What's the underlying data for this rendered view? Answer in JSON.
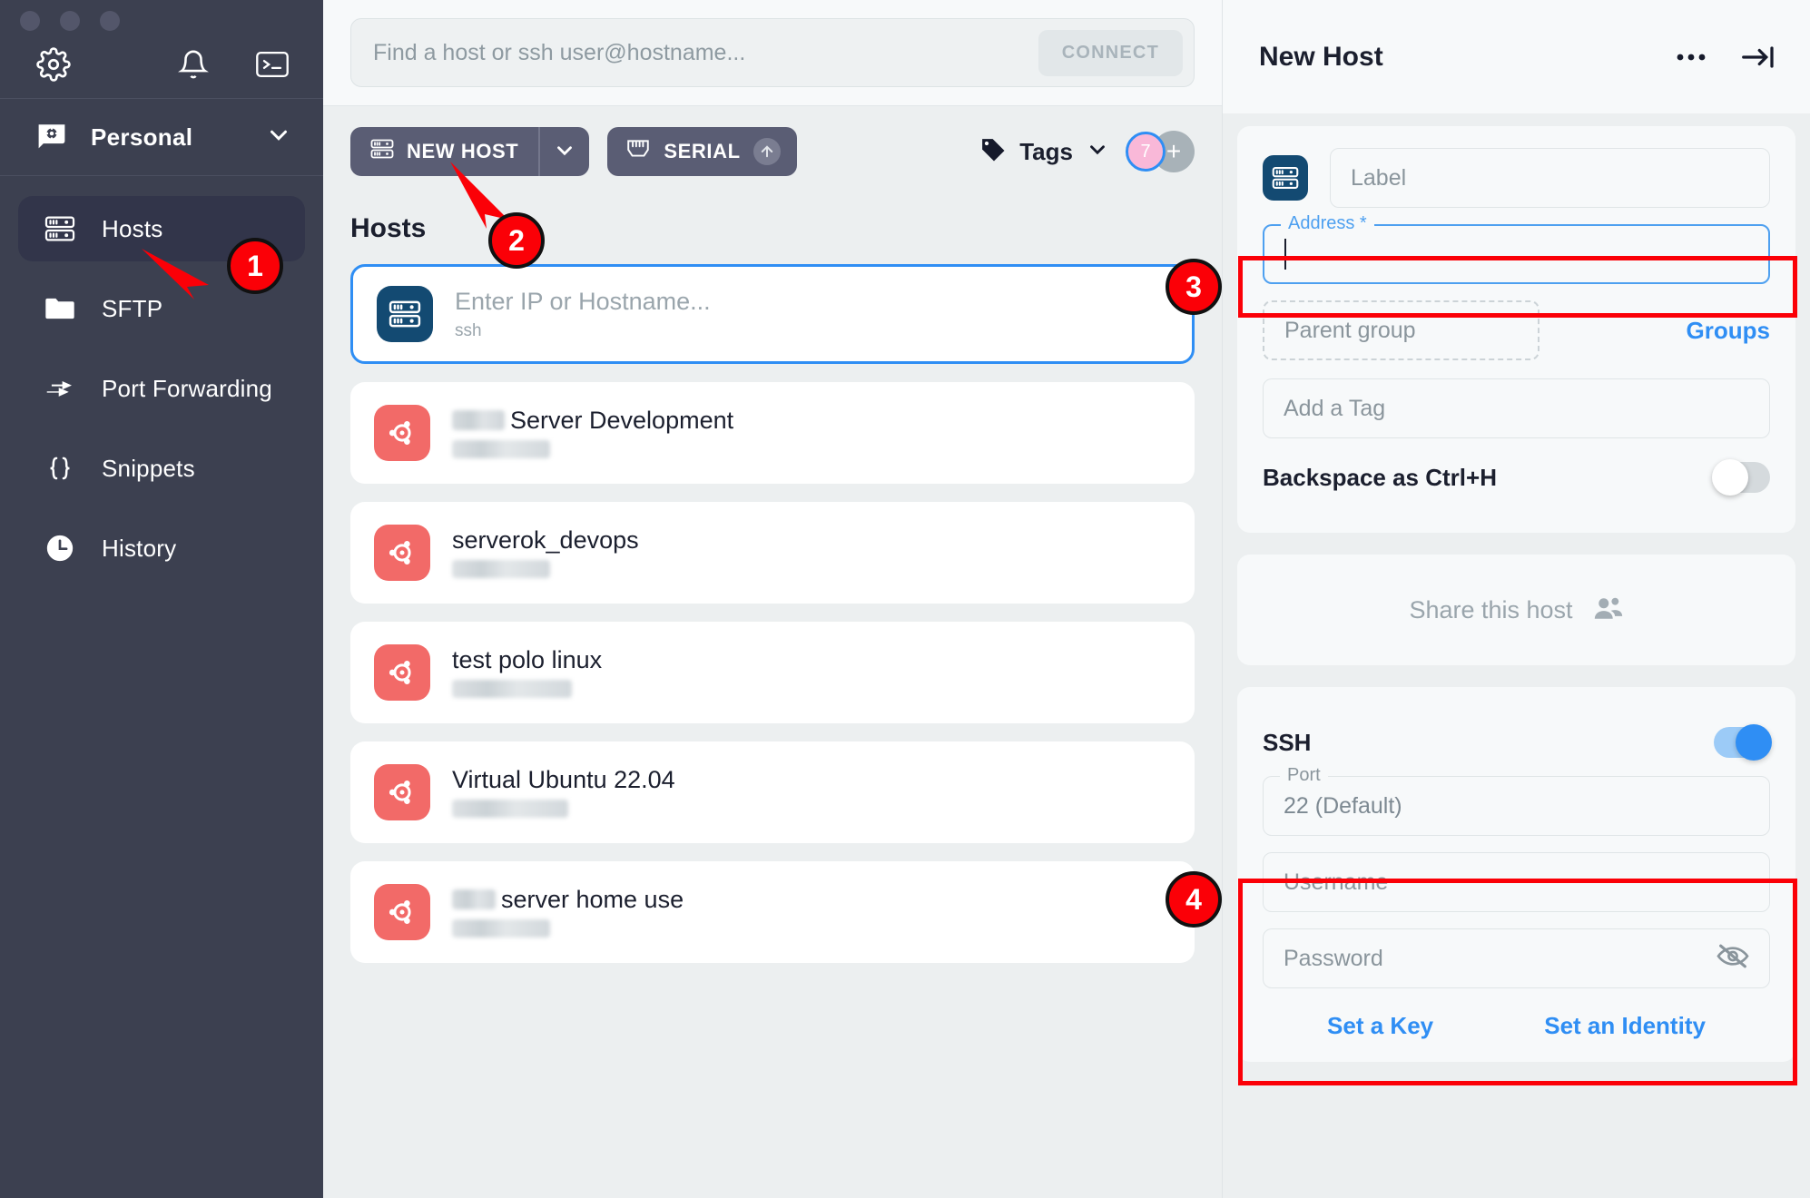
{
  "app": {
    "sidebar": {
      "team": {
        "name": "Personal",
        "icon": "vault-icon",
        "chevron": "chevron-down-icon"
      },
      "top_icons": [
        "gear-icon",
        "bell-icon",
        "terminal-icon"
      ],
      "items": [
        {
          "label": "Hosts",
          "icon": "server-icon",
          "active": true
        },
        {
          "label": "SFTP",
          "icon": "folder-icon",
          "active": false
        },
        {
          "label": "Port Forwarding",
          "icon": "forward-arrow-icon",
          "active": false
        },
        {
          "label": "Snippets",
          "icon": "braces-icon",
          "active": false
        },
        {
          "label": "History",
          "icon": "clock-icon",
          "active": false
        }
      ]
    },
    "search": {
      "placeholder": "Find a host or ssh user@hostname...",
      "value": "",
      "connect_label": "CONNECT"
    },
    "toolbar": {
      "new_host_label": "NEW HOST",
      "new_host_caret": "chevron-down-icon",
      "serial_label": "SERIAL",
      "serial_icon": "ethernet-port-icon",
      "serial_badge": "arrow-up-icon",
      "tags_label": "Tags",
      "tags_caret": "chevron-down-icon",
      "avatar_count": "7",
      "avatar_add": "+"
    },
    "hosts": {
      "section_title": "Hosts",
      "new_host_row": {
        "placeholder": "Enter IP or Hostname...",
        "subtitle": "ssh",
        "icon": "server-icon"
      },
      "items": [
        {
          "redacted_prefix": true,
          "title": "Server Development",
          "subtitle_redacted": true,
          "icon": "ubuntu-icon"
        },
        {
          "redacted_prefix": false,
          "title": "serverok_devops",
          "subtitle_redacted": true,
          "icon": "ubuntu-icon"
        },
        {
          "redacted_prefix": false,
          "title": "test polo linux",
          "subtitle_redacted": true,
          "icon": "ubuntu-icon"
        },
        {
          "redacted_prefix": false,
          "title": "Virtual Ubuntu 22.04",
          "subtitle_redacted": true,
          "icon": "ubuntu-icon"
        },
        {
          "redacted_prefix": true,
          "title": "server home use",
          "subtitle_redacted": true,
          "icon": "ubuntu-icon"
        }
      ]
    },
    "right_panel": {
      "title": "New Host",
      "more_icon": "ellipsis-icon",
      "collapse_icon": "arrow-to-line-icon",
      "label_field": {
        "placeholder": "Label",
        "value": "",
        "icon": "server-icon"
      },
      "address_field": {
        "legend": "Address *",
        "value": "",
        "focused": true
      },
      "parent_group": {
        "placeholder": "Parent group",
        "value": ""
      },
      "groups_link": "Groups",
      "tag_field": {
        "placeholder": "Add a Tag",
        "value": ""
      },
      "backspace_toggle": {
        "label": "Backspace as Ctrl+H",
        "on": false
      },
      "share": {
        "label": "Share this host",
        "icon": "people-icon"
      },
      "ssh_toggle": {
        "label": "SSH",
        "on": true
      },
      "port_field": {
        "legend": "Port",
        "value": "22 (Default)"
      },
      "username_field": {
        "placeholder": "Username",
        "value": ""
      },
      "password_field": {
        "placeholder": "Password",
        "value": "",
        "icon": "eye-off-icon"
      },
      "set_key_link": "Set a Key",
      "set_identity_link": "Set an Identity"
    },
    "callouts": [
      {
        "number": "1",
        "target": "sidebar-item-hosts"
      },
      {
        "number": "2",
        "target": "new-host-button"
      },
      {
        "number": "3",
        "target": "address-field"
      },
      {
        "number": "4",
        "target": "ssh-credentials-group"
      }
    ],
    "colors": {
      "sidebar_bg": "#3c4050",
      "accent_blue": "#2f8ef4",
      "callout_red": "#fb0007",
      "ubuntu_red": "#f26a68",
      "host_icon_blue": "#134a72"
    }
  }
}
